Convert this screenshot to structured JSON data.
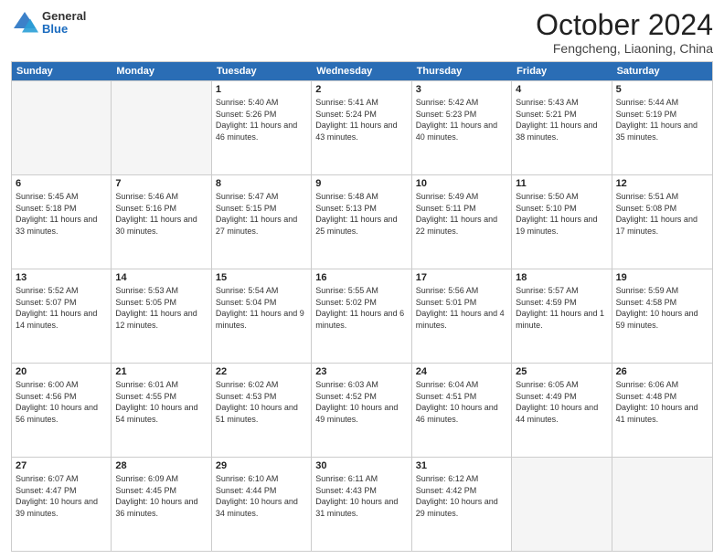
{
  "header": {
    "logo_general": "General",
    "logo_blue": "Blue",
    "month": "October 2024",
    "location": "Fengcheng, Liaoning, China"
  },
  "days": [
    "Sunday",
    "Monday",
    "Tuesday",
    "Wednesday",
    "Thursday",
    "Friday",
    "Saturday"
  ],
  "weeks": [
    [
      {
        "day": "",
        "empty": true
      },
      {
        "day": "",
        "empty": true
      },
      {
        "day": "1",
        "sunrise": "Sunrise: 5:40 AM",
        "sunset": "Sunset: 5:26 PM",
        "daylight": "Daylight: 11 hours and 46 minutes."
      },
      {
        "day": "2",
        "sunrise": "Sunrise: 5:41 AM",
        "sunset": "Sunset: 5:24 PM",
        "daylight": "Daylight: 11 hours and 43 minutes."
      },
      {
        "day": "3",
        "sunrise": "Sunrise: 5:42 AM",
        "sunset": "Sunset: 5:23 PM",
        "daylight": "Daylight: 11 hours and 40 minutes."
      },
      {
        "day": "4",
        "sunrise": "Sunrise: 5:43 AM",
        "sunset": "Sunset: 5:21 PM",
        "daylight": "Daylight: 11 hours and 38 minutes."
      },
      {
        "day": "5",
        "sunrise": "Sunrise: 5:44 AM",
        "sunset": "Sunset: 5:19 PM",
        "daylight": "Daylight: 11 hours and 35 minutes."
      }
    ],
    [
      {
        "day": "6",
        "sunrise": "Sunrise: 5:45 AM",
        "sunset": "Sunset: 5:18 PM",
        "daylight": "Daylight: 11 hours and 33 minutes."
      },
      {
        "day": "7",
        "sunrise": "Sunrise: 5:46 AM",
        "sunset": "Sunset: 5:16 PM",
        "daylight": "Daylight: 11 hours and 30 minutes."
      },
      {
        "day": "8",
        "sunrise": "Sunrise: 5:47 AM",
        "sunset": "Sunset: 5:15 PM",
        "daylight": "Daylight: 11 hours and 27 minutes."
      },
      {
        "day": "9",
        "sunrise": "Sunrise: 5:48 AM",
        "sunset": "Sunset: 5:13 PM",
        "daylight": "Daylight: 11 hours and 25 minutes."
      },
      {
        "day": "10",
        "sunrise": "Sunrise: 5:49 AM",
        "sunset": "Sunset: 5:11 PM",
        "daylight": "Daylight: 11 hours and 22 minutes."
      },
      {
        "day": "11",
        "sunrise": "Sunrise: 5:50 AM",
        "sunset": "Sunset: 5:10 PM",
        "daylight": "Daylight: 11 hours and 19 minutes."
      },
      {
        "day": "12",
        "sunrise": "Sunrise: 5:51 AM",
        "sunset": "Sunset: 5:08 PM",
        "daylight": "Daylight: 11 hours and 17 minutes."
      }
    ],
    [
      {
        "day": "13",
        "sunrise": "Sunrise: 5:52 AM",
        "sunset": "Sunset: 5:07 PM",
        "daylight": "Daylight: 11 hours and 14 minutes."
      },
      {
        "day": "14",
        "sunrise": "Sunrise: 5:53 AM",
        "sunset": "Sunset: 5:05 PM",
        "daylight": "Daylight: 11 hours and 12 minutes."
      },
      {
        "day": "15",
        "sunrise": "Sunrise: 5:54 AM",
        "sunset": "Sunset: 5:04 PM",
        "daylight": "Daylight: 11 hours and 9 minutes."
      },
      {
        "day": "16",
        "sunrise": "Sunrise: 5:55 AM",
        "sunset": "Sunset: 5:02 PM",
        "daylight": "Daylight: 11 hours and 6 minutes."
      },
      {
        "day": "17",
        "sunrise": "Sunrise: 5:56 AM",
        "sunset": "Sunset: 5:01 PM",
        "daylight": "Daylight: 11 hours and 4 minutes."
      },
      {
        "day": "18",
        "sunrise": "Sunrise: 5:57 AM",
        "sunset": "Sunset: 4:59 PM",
        "daylight": "Daylight: 11 hours and 1 minute."
      },
      {
        "day": "19",
        "sunrise": "Sunrise: 5:59 AM",
        "sunset": "Sunset: 4:58 PM",
        "daylight": "Daylight: 10 hours and 59 minutes."
      }
    ],
    [
      {
        "day": "20",
        "sunrise": "Sunrise: 6:00 AM",
        "sunset": "Sunset: 4:56 PM",
        "daylight": "Daylight: 10 hours and 56 minutes."
      },
      {
        "day": "21",
        "sunrise": "Sunrise: 6:01 AM",
        "sunset": "Sunset: 4:55 PM",
        "daylight": "Daylight: 10 hours and 54 minutes."
      },
      {
        "day": "22",
        "sunrise": "Sunrise: 6:02 AM",
        "sunset": "Sunset: 4:53 PM",
        "daylight": "Daylight: 10 hours and 51 minutes."
      },
      {
        "day": "23",
        "sunrise": "Sunrise: 6:03 AM",
        "sunset": "Sunset: 4:52 PM",
        "daylight": "Daylight: 10 hours and 49 minutes."
      },
      {
        "day": "24",
        "sunrise": "Sunrise: 6:04 AM",
        "sunset": "Sunset: 4:51 PM",
        "daylight": "Daylight: 10 hours and 46 minutes."
      },
      {
        "day": "25",
        "sunrise": "Sunrise: 6:05 AM",
        "sunset": "Sunset: 4:49 PM",
        "daylight": "Daylight: 10 hours and 44 minutes."
      },
      {
        "day": "26",
        "sunrise": "Sunrise: 6:06 AM",
        "sunset": "Sunset: 4:48 PM",
        "daylight": "Daylight: 10 hours and 41 minutes."
      }
    ],
    [
      {
        "day": "27",
        "sunrise": "Sunrise: 6:07 AM",
        "sunset": "Sunset: 4:47 PM",
        "daylight": "Daylight: 10 hours and 39 minutes."
      },
      {
        "day": "28",
        "sunrise": "Sunrise: 6:09 AM",
        "sunset": "Sunset: 4:45 PM",
        "daylight": "Daylight: 10 hours and 36 minutes."
      },
      {
        "day": "29",
        "sunrise": "Sunrise: 6:10 AM",
        "sunset": "Sunset: 4:44 PM",
        "daylight": "Daylight: 10 hours and 34 minutes."
      },
      {
        "day": "30",
        "sunrise": "Sunrise: 6:11 AM",
        "sunset": "Sunset: 4:43 PM",
        "daylight": "Daylight: 10 hours and 31 minutes."
      },
      {
        "day": "31",
        "sunrise": "Sunrise: 6:12 AM",
        "sunset": "Sunset: 4:42 PM",
        "daylight": "Daylight: 10 hours and 29 minutes."
      },
      {
        "day": "",
        "empty": true
      },
      {
        "day": "",
        "empty": true
      }
    ]
  ]
}
